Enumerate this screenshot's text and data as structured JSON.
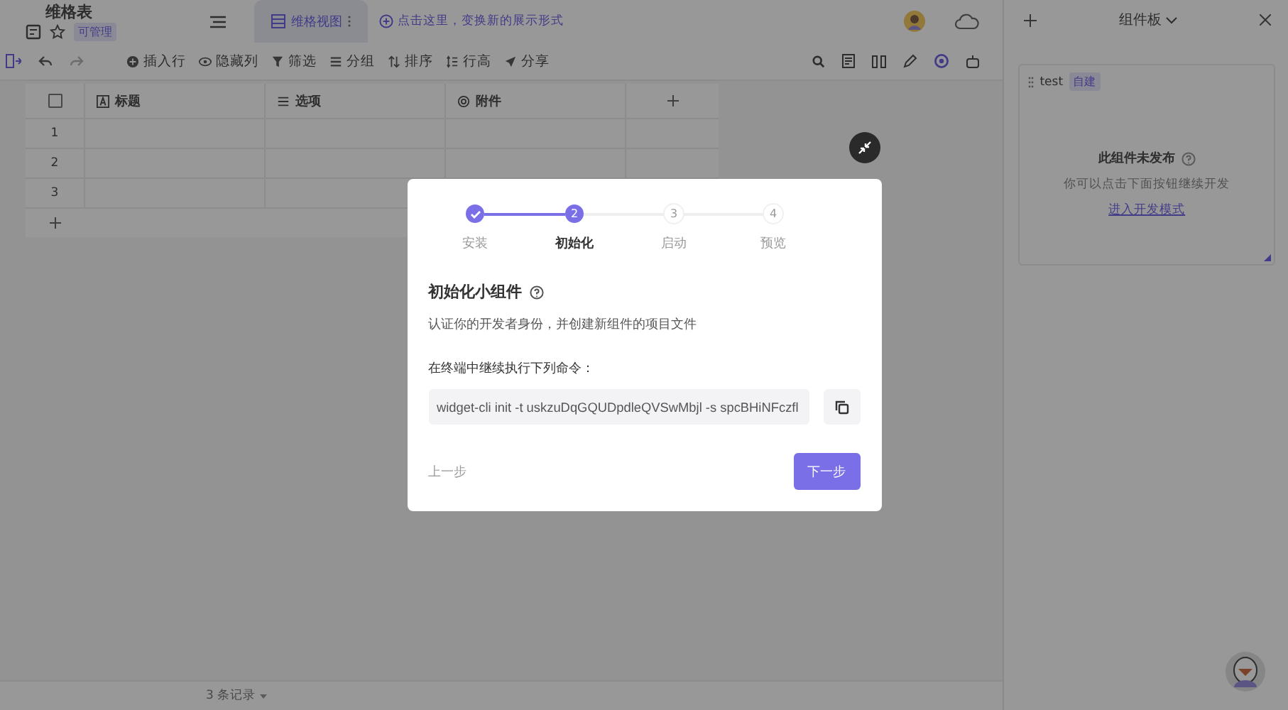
{
  "doc": {
    "title": "维格表",
    "badge": "可管理"
  },
  "view_tab": {
    "label": "维格视图",
    "selected": true
  },
  "add_view_hint": "点击这里，变换新的展示形式",
  "toolbar": [
    {
      "label": "插入行",
      "kind": "insert"
    },
    {
      "label": "隐藏列",
      "kind": "hide"
    },
    {
      "label": "筛选",
      "kind": "filter"
    },
    {
      "label": "分组",
      "kind": "group"
    },
    {
      "label": "排序",
      "kind": "sort"
    },
    {
      "label": "行高",
      "kind": "height"
    },
    {
      "label": "分享",
      "kind": "share"
    }
  ],
  "table": {
    "select_all_checked": false,
    "columns": [
      {
        "label": "标题",
        "kind": "text"
      },
      {
        "label": "选项",
        "kind": "options"
      },
      {
        "label": "附件",
        "kind": "attachment"
      }
    ],
    "rows": [
      "1",
      "2",
      "3"
    ]
  },
  "footer": {
    "record_count": "3 条记录"
  },
  "panel": {
    "title": "组件板",
    "widget": {
      "name": "test",
      "tag": "自建",
      "status": "此组件未发布",
      "hint": "你可以点击下面按钮继续开发",
      "link": "进入开发模式"
    }
  },
  "dialog": {
    "steps": [
      {
        "label": "安装",
        "completed": true,
        "selected": false
      },
      {
        "number": "2",
        "label": "初始化",
        "completed": false,
        "selected": true
      },
      {
        "number": "3",
        "label": "启动",
        "completed": false,
        "selected": false
      },
      {
        "number": "4",
        "label": "预览",
        "completed": false,
        "selected": false
      }
    ],
    "heading": "初始化小组件",
    "description": "认证你的开发者身份，并创建新组件的项目文件",
    "command_label": "在终端中继续执行下列命令：",
    "command": "widget-cli init -t uskzuDqGQUDpdleQVSwMbjl -s spcBHiNFczfl",
    "back": "上一步",
    "next": "下一步"
  }
}
